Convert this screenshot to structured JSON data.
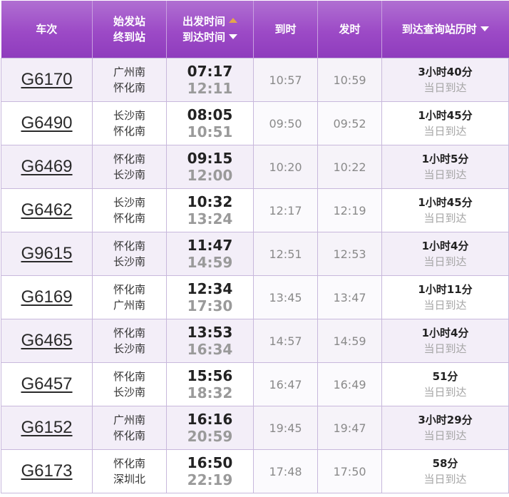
{
  "header": {
    "train": "车次",
    "start_station": "始发站",
    "end_station": "终到站",
    "depart_time": "出发时间",
    "arrive_time": "到达时间",
    "arrive": "到时",
    "depart": "发时",
    "duration": "到达查询站历时"
  },
  "rows": [
    {
      "train": "G6170",
      "from": "广州南",
      "to": "怀化南",
      "dep": "07:17",
      "arr": "12:11",
      "at": "10:57",
      "lv": "10:59",
      "dur": "3小时40分",
      "note": "当日到达"
    },
    {
      "train": "G6490",
      "from": "长沙南",
      "to": "怀化南",
      "dep": "08:05",
      "arr": "10:51",
      "at": "09:50",
      "lv": "09:52",
      "dur": "1小时45分",
      "note": "当日到达"
    },
    {
      "train": "G6469",
      "from": "怀化南",
      "to": "长沙南",
      "dep": "09:15",
      "arr": "12:00",
      "at": "10:20",
      "lv": "10:22",
      "dur": "1小时5分",
      "note": "当日到达"
    },
    {
      "train": "G6462",
      "from": "长沙南",
      "to": "怀化南",
      "dep": "10:32",
      "arr": "13:24",
      "at": "12:17",
      "lv": "12:19",
      "dur": "1小时45分",
      "note": "当日到达"
    },
    {
      "train": "G9615",
      "from": "怀化南",
      "to": "长沙南",
      "dep": "11:47",
      "arr": "14:59",
      "at": "12:51",
      "lv": "12:53",
      "dur": "1小时4分",
      "note": "当日到达"
    },
    {
      "train": "G6169",
      "from": "怀化南",
      "to": "广州南",
      "dep": "12:34",
      "arr": "17:30",
      "at": "13:45",
      "lv": "13:47",
      "dur": "1小时11分",
      "note": "当日到达"
    },
    {
      "train": "G6465",
      "from": "怀化南",
      "to": "长沙南",
      "dep": "13:53",
      "arr": "16:34",
      "at": "14:57",
      "lv": "14:59",
      "dur": "1小时4分",
      "note": "当日到达"
    },
    {
      "train": "G6457",
      "from": "怀化南",
      "to": "长沙南",
      "dep": "15:56",
      "arr": "18:32",
      "at": "16:47",
      "lv": "16:49",
      "dur": "51分",
      "note": "当日到达"
    },
    {
      "train": "G6152",
      "from": "广州南",
      "to": "怀化南",
      "dep": "16:16",
      "arr": "20:59",
      "at": "19:45",
      "lv": "19:47",
      "dur": "3小时29分",
      "note": "当日到达"
    },
    {
      "train": "G6173",
      "from": "怀化南",
      "to": "深圳北",
      "dep": "16:50",
      "arr": "22:19",
      "at": "17:48",
      "lv": "17:50",
      "dur": "58分",
      "note": "当日到达"
    }
  ],
  "icons": {
    "sort_asc": "triangle-up-icon",
    "sort_desc": "triangle-down-icon"
  },
  "colors": {
    "header": "#9c4ac6",
    "sort_active": "#e3a64a",
    "row_alt": "#f3eef8",
    "border": "#c8b8dc"
  }
}
